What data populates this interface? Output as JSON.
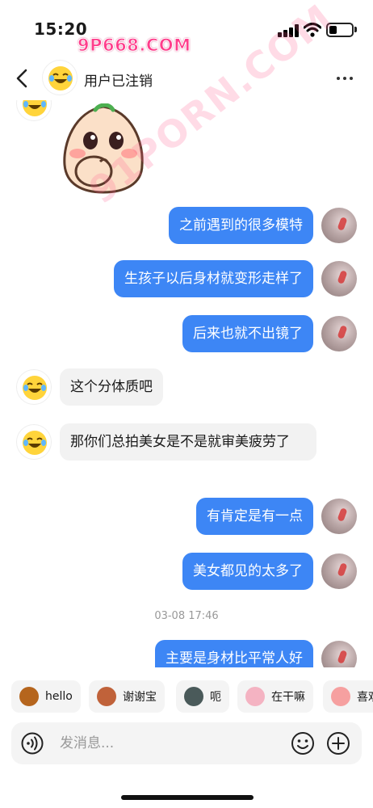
{
  "status_bar": {
    "time": "15:20"
  },
  "watermark": {
    "top_text": "9P668.COM",
    "diagonal_text": "91PORN.COM"
  },
  "header": {
    "contact_name": "用户已注销"
  },
  "messages": [
    {
      "side": "in",
      "kind": "sticker"
    },
    {
      "side": "out",
      "text": "之前遇到的很多模特"
    },
    {
      "side": "out",
      "text": "生孩子以后身材就变形走样了"
    },
    {
      "side": "out",
      "text": "后来也就不出镜了"
    },
    {
      "side": "in",
      "text": "这个分体质吧"
    },
    {
      "side": "in",
      "text": "那你们总拍美女是不是就审美疲劳了"
    },
    {
      "side": "out",
      "text": "有肯定是有一点"
    },
    {
      "side": "out",
      "text": "美女都见的太多了"
    },
    {
      "kind": "timestamp",
      "text": "03-08 17:46"
    },
    {
      "side": "out",
      "text": "主要是身材比平常人好"
    }
  ],
  "quick_replies": [
    {
      "label": "hello",
      "icon": "monkey-icon"
    },
    {
      "label": "谢谢宝",
      "icon": "monkey-flower-icon"
    },
    {
      "label": "呃",
      "icon": "cat-icon"
    },
    {
      "label": "在干嘛",
      "icon": "mask-icon"
    },
    {
      "label": "喜欢",
      "icon": "doll-icon"
    }
  ],
  "composer": {
    "placeholder": "发消息..."
  },
  "colors": {
    "accent": "#3d86f5",
    "incoming_bubble": "#f2f2f2",
    "watermark": "#ff3d8b"
  }
}
